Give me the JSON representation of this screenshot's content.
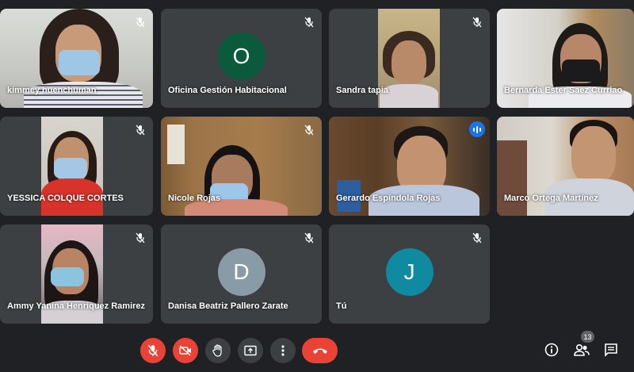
{
  "participants": [
    {
      "name": "kimmey huenchuman",
      "muted": true,
      "avatar_letter": "",
      "avatar_color": ""
    },
    {
      "name": "Oficina Gestión Habitacional",
      "muted": true,
      "avatar_letter": "O",
      "avatar_color": "#0b5a3e"
    },
    {
      "name": "Sandra tapia",
      "muted": true,
      "avatar_letter": "",
      "avatar_color": ""
    },
    {
      "name": "Bernarda Ester Saez Curriao",
      "muted": false,
      "avatar_letter": "",
      "avatar_color": ""
    },
    {
      "name": "YESSICA COLQUE CORTES",
      "muted": true,
      "avatar_letter": "",
      "avatar_color": ""
    },
    {
      "name": "Nicole Rojas",
      "muted": true,
      "avatar_letter": "",
      "avatar_color": ""
    },
    {
      "name": "Gerardo Espíndola Rojas",
      "muted": false,
      "speaking": true,
      "avatar_letter": "",
      "avatar_color": ""
    },
    {
      "name": "Marco Ortega Martínez",
      "muted": false,
      "avatar_letter": "",
      "avatar_color": ""
    },
    {
      "name": "Ammy Yanina Henriquez Ramirez",
      "muted": true,
      "avatar_letter": "",
      "avatar_color": ""
    },
    {
      "name": "Danisa Beatriz Pallero Zarate",
      "muted": true,
      "avatar_letter": "D",
      "avatar_color": "#8a9ba8"
    },
    {
      "name": "Tú",
      "muted": true,
      "avatar_letter": "J",
      "avatar_color": "#0f8aa0"
    }
  ],
  "controls": {
    "mic_icon": "mic-off-icon",
    "camera_icon": "camera-off-icon",
    "hand_icon": "raise-hand-icon",
    "present_icon": "present-screen-icon",
    "more_icon": "more-options-icon",
    "end_icon": "end-call-icon"
  },
  "side": {
    "info_icon": "info-icon",
    "people_icon": "people-icon",
    "people_count": "13",
    "chat_icon": "chat-icon"
  },
  "colors": {
    "background": "#202124",
    "tile": "#3c4043",
    "danger": "#ea4335",
    "speaking": "#1a73e8"
  }
}
